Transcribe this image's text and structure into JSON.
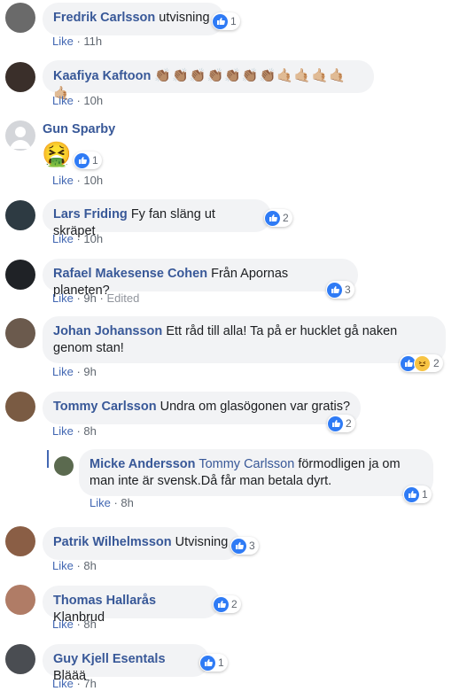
{
  "like_label": "Like",
  "comments": [
    {
      "author": "Fredrik Carlsson",
      "text": "utvisning",
      "time": "11h",
      "reactions": "1",
      "avatar_color": "#6a6a6a"
    },
    {
      "author": "Kaafiya Kaftoon",
      "text": "👏🏽👏🏽👏🏽👏🏽👏🏽👏🏽👏🏽🤙🏼🤙🏼🤙🏼🤙🏼🤙🏼",
      "time": "10h",
      "avatar_color": "#3a2f2a"
    },
    {
      "author": "Gun Sparby",
      "text": "🤮",
      "time": "10h",
      "reactions": "1",
      "avatar_color": "#d4d6da"
    },
    {
      "author": "Lars Friding",
      "text": "Fy fan släng ut skräpet",
      "time": "10h",
      "reactions": "2",
      "avatar_color": "#2d3a42"
    },
    {
      "author": "Rafael Makesense Cohen",
      "text": "Från Apornas planeten?",
      "time": "9h",
      "edited": "Edited",
      "reactions": "3",
      "avatar_color": "#1f2226"
    },
    {
      "author": "Johan Johansson",
      "text_line1": "Ett råd till alla! Ta på er hucklet gå naken",
      "text_line2": "genom stan!",
      "time": "9h",
      "reactions": "2",
      "avatar_color": "#6b5a4d"
    },
    {
      "author": "Tommy Carlsson",
      "text": "Undra om glasögonen var gratis?",
      "time": "8h",
      "reactions": "2",
      "avatar_color": "#7a5b43"
    },
    {
      "author": "Micke Andersson",
      "mention": "Tommy Carlsson",
      "text_line1": "förmodligen ja om",
      "text_line2": "man inte är svensk.Då får man betala dyrt.",
      "time": "8h",
      "reactions": "1",
      "avatar_color": "#5b6a4f"
    },
    {
      "author": "Patrik Wilhelmsson",
      "text": "Utvisning",
      "time": "8h",
      "reactions": "3",
      "avatar_color": "#8a5e45"
    },
    {
      "author": "Thomas Hallarås",
      "text": "Klanbrud",
      "time": "8h",
      "reactions": "2",
      "avatar_color": "#b07c66"
    },
    {
      "author": "Guy Kjell Esentals",
      "text": "Bläää",
      "time": "7h",
      "reactions": "1",
      "avatar_color": "#4a4d52"
    }
  ]
}
